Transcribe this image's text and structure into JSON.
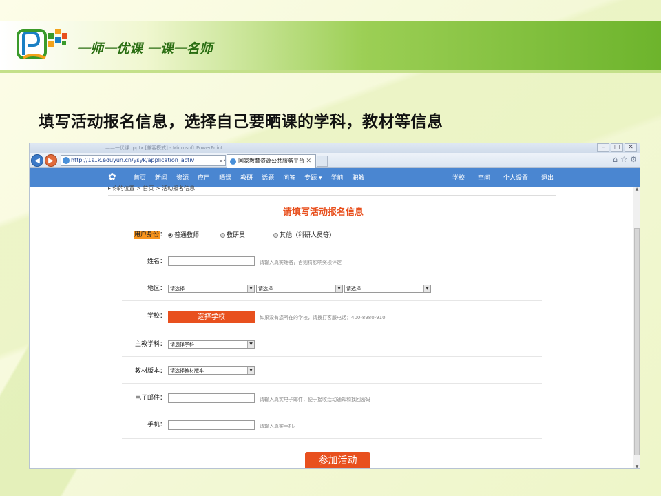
{
  "slide": {
    "logo_text": "一师一优课  一课一名师",
    "title": "填写活动报名信息，选择自己要晒课的学科，教材等信息"
  },
  "browser": {
    "window_title": "——一优课..pptx [兼容模式] - Microsoft PowerPoint",
    "url": "http://1s1k.eduyun.cn/ysyk/application_activ",
    "address_tools": "⌕ ▾ ☰ C ✕",
    "tab_title": "国家教育资源公共服务平台",
    "icons": [
      "back-arrow",
      "forward-arrow",
      "home",
      "star",
      "gear"
    ]
  },
  "site": {
    "nav": [
      "首页",
      "新闻",
      "资源",
      "应用",
      "晒课",
      "教研",
      "话题",
      "问答",
      "专题 ▾",
      "学前",
      "职教"
    ],
    "right_nav": [
      "学校",
      "空间",
      "个人设置",
      "退出"
    ],
    "breadcrumb": "▸ 你的位置 > 首页 > 活动报名信息"
  },
  "form": {
    "title": "请填写活动报名信息",
    "identity_label": "用户身份",
    "identity_colon": "：",
    "identity_options": [
      {
        "label": "普通教师",
        "selected": true
      },
      {
        "label": "教研员",
        "selected": false
      },
      {
        "label": "其他（科研人员等）",
        "selected": false
      }
    ],
    "name_label": "姓名：",
    "name_hint": "请输入真实姓名，否则将影响奖项评定",
    "region_label": "地区：",
    "region_selects": [
      "请选择",
      "请选择",
      "请选择"
    ],
    "school_label": "学校：",
    "school_button": "选择学校",
    "school_hint": "如果没有您所在的学校，请拨打客服电话：400-8980-910",
    "subject_label": "主教学科：",
    "subject_select": "请选择学科",
    "edition_label": "教材版本：",
    "edition_select": "请选择教材版本",
    "email_label": "电子邮件：",
    "email_hint": "请输入真实电子邮件，便于接收活动通知和找回密码",
    "phone_label": "手机：",
    "phone_hint": "请输入真实手机。",
    "submit": "参加活动"
  },
  "colors": {
    "accent": "#e8501e",
    "highlight": "#f7941d",
    "site_bar": "#4a86d1",
    "header_green": "#6db42c"
  }
}
